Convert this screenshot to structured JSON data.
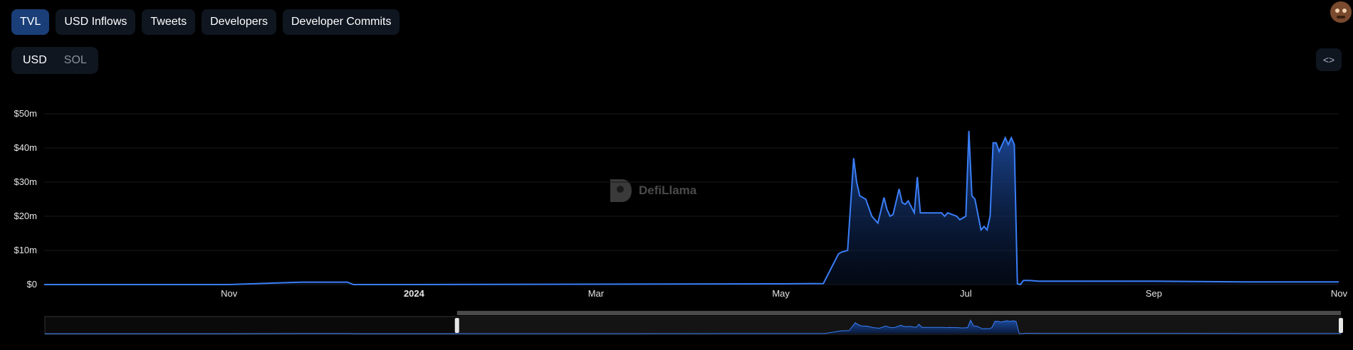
{
  "tabs": [
    {
      "label": "TVL",
      "active": true
    },
    {
      "label": "USD Inflows",
      "active": false
    },
    {
      "label": "Tweets",
      "active": false
    },
    {
      "label": "Developers",
      "active": false
    },
    {
      "label": "Developer Commits",
      "active": false
    }
  ],
  "denomination": {
    "options": [
      "USD",
      "SOL"
    ],
    "selected": "USD"
  },
  "embed_icon": "code-brackets-icon",
  "watermark": "DefiLlama",
  "colors": {
    "line": "#3a7ef7",
    "fill_top": "#1c4a9c",
    "background": "#000000",
    "active_tab": "#1a3f78"
  },
  "chart_data": {
    "type": "area",
    "title": "",
    "xlabel": "",
    "ylabel": "",
    "ylim": [
      0,
      50000000
    ],
    "yticks": [
      "$0",
      "$10m",
      "$20m",
      "$30m",
      "$40m",
      "$50m"
    ],
    "xticks": [
      "Nov",
      "2024",
      "Mar",
      "May",
      "Jul",
      "Sep",
      "Nov"
    ],
    "grid": true,
    "series": [
      {
        "x": [
          "2023-09-01",
          "2023-10-01",
          "2023-11-01",
          "2023-11-25",
          "2023-12-10",
          "2023-12-12",
          "2024-01-01",
          "2024-03-01",
          "2024-05-01",
          "2024-05-15",
          "2024-05-20",
          "2024-05-21",
          "2024-05-23",
          "2024-05-25",
          "2024-05-26",
          "2024-05-27",
          "2024-05-29",
          "2024-05-31",
          "2024-06-02",
          "2024-06-04",
          "2024-06-05",
          "2024-06-06",
          "2024-06-07",
          "2024-06-09",
          "2024-06-10",
          "2024-06-11",
          "2024-06-12",
          "2024-06-14",
          "2024-06-15",
          "2024-06-16",
          "2024-06-18",
          "2024-06-20",
          "2024-06-21",
          "2024-06-23",
          "2024-06-24",
          "2024-06-25",
          "2024-06-28",
          "2024-06-29",
          "2024-07-01",
          "2024-07-02",
          "2024-07-03",
          "2024-07-04",
          "2024-07-06",
          "2024-07-07",
          "2024-07-08",
          "2024-07-09",
          "2024-07-10",
          "2024-07-11",
          "2024-07-12",
          "2024-07-14",
          "2024-07-15",
          "2024-07-16",
          "2024-07-17",
          "2024-07-18",
          "2024-07-19",
          "2024-07-20",
          "2024-07-22",
          "2024-07-25",
          "2024-08-01",
          "2024-09-01",
          "2024-10-01",
          "2024-11-01"
        ],
        "values": [
          0,
          0,
          0,
          700000,
          700000,
          0,
          0,
          100000,
          200000,
          300000,
          9000000,
          9500000,
          10000000,
          37000000,
          30000000,
          26000000,
          25000000,
          20000000,
          18000000,
          25500000,
          22000000,
          20000000,
          20500000,
          28000000,
          24000000,
          23500000,
          24500000,
          21000000,
          31500000,
          21000000,
          21000000,
          21000000,
          21000000,
          21000000,
          20000000,
          21000000,
          20000000,
          19000000,
          20000000,
          45000000,
          26000000,
          25000000,
          16000000,
          17000000,
          16000000,
          20000000,
          41500000,
          41500000,
          39000000,
          43000000,
          41000000,
          43000000,
          41000000,
          200000,
          0,
          1200000,
          1200000,
          1000000,
          1000000,
          1000000,
          800000,
          800000
        ]
      }
    ]
  }
}
